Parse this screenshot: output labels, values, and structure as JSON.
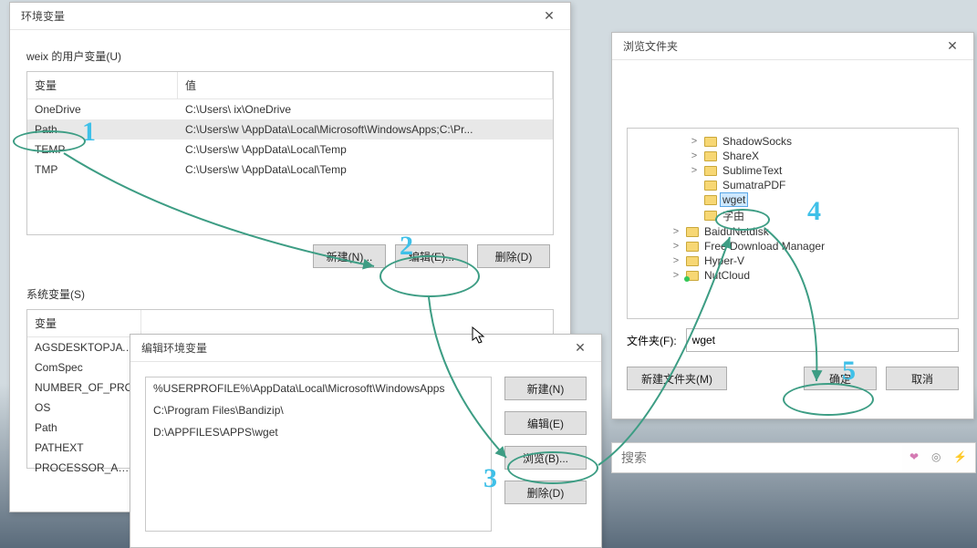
{
  "env_dialog": {
    "title": "环境变量",
    "user_section_label": "weix 的用户变量(U)",
    "headers": {
      "variable": "变量",
      "value": "值"
    },
    "user_vars": [
      {
        "name": "OneDrive",
        "value": "C:\\Users\\   ix\\OneDrive"
      },
      {
        "name": "Path",
        "value": "C:\\Users\\w   \\AppData\\Local\\Microsoft\\WindowsApps;C:\\Pr..."
      },
      {
        "name": "TEMP",
        "value": "C:\\Users\\w   \\AppData\\Local\\Temp"
      },
      {
        "name": "TMP",
        "value": "C:\\Users\\w   \\AppData\\Local\\Temp"
      }
    ],
    "buttons": {
      "new": "新建(N)...",
      "edit": "编辑(E)...",
      "delete": "删除(D)"
    },
    "sys_section_label": "系统变量(S)",
    "sys_vars": [
      {
        "name": "AGSDESKTOPJAVA"
      },
      {
        "name": "ComSpec"
      },
      {
        "name": "NUMBER_OF_PRO"
      },
      {
        "name": "OS"
      },
      {
        "name": "Path"
      },
      {
        "name": "PATHEXT"
      },
      {
        "name": "PROCESSOR_ARCH"
      }
    ]
  },
  "edit_dialog": {
    "title": "编辑环境变量",
    "items": [
      "%USERPROFILE%\\AppData\\Local\\Microsoft\\WindowsApps",
      "C:\\Program Files\\Bandizip\\",
      "D:\\APPFILES\\APPS\\wget"
    ],
    "buttons": {
      "new": "新建(N)",
      "edit": "编辑(E)",
      "browse": "浏览(B)...",
      "delete": "删除(D)"
    }
  },
  "browse_dialog": {
    "title": "浏览文件夹",
    "tree": [
      {
        "level": 2,
        "exp": ">",
        "name": "ShadowSocks"
      },
      {
        "level": 2,
        "exp": ">",
        "name": "ShareX"
      },
      {
        "level": 2,
        "exp": ">",
        "name": "SublimeText"
      },
      {
        "level": 2,
        "exp": "",
        "name": "SumatraPDF"
      },
      {
        "level": 2,
        "exp": "",
        "name": "wget",
        "selected": true
      },
      {
        "level": 2,
        "exp": "",
        "name": "字由"
      },
      {
        "level": 1,
        "exp": ">",
        "name": "BaiduNetdisk"
      },
      {
        "level": 1,
        "exp": ">",
        "name": "Free Download Manager"
      },
      {
        "level": 1,
        "exp": ">",
        "name": "Hyper-V"
      },
      {
        "level": 1,
        "exp": ">",
        "name": "NutCloud",
        "green": true
      }
    ],
    "folder_label": "文件夹(F):",
    "folder_value": "wget",
    "buttons": {
      "newfolder": "新建文件夹(M)",
      "ok": "确定",
      "cancel": "取消"
    }
  },
  "searchbar": {
    "placeholder": "搜索"
  },
  "annotations": {
    "a1": "1",
    "a2": "2",
    "a3": "3",
    "a4": "4",
    "a5": "5"
  }
}
